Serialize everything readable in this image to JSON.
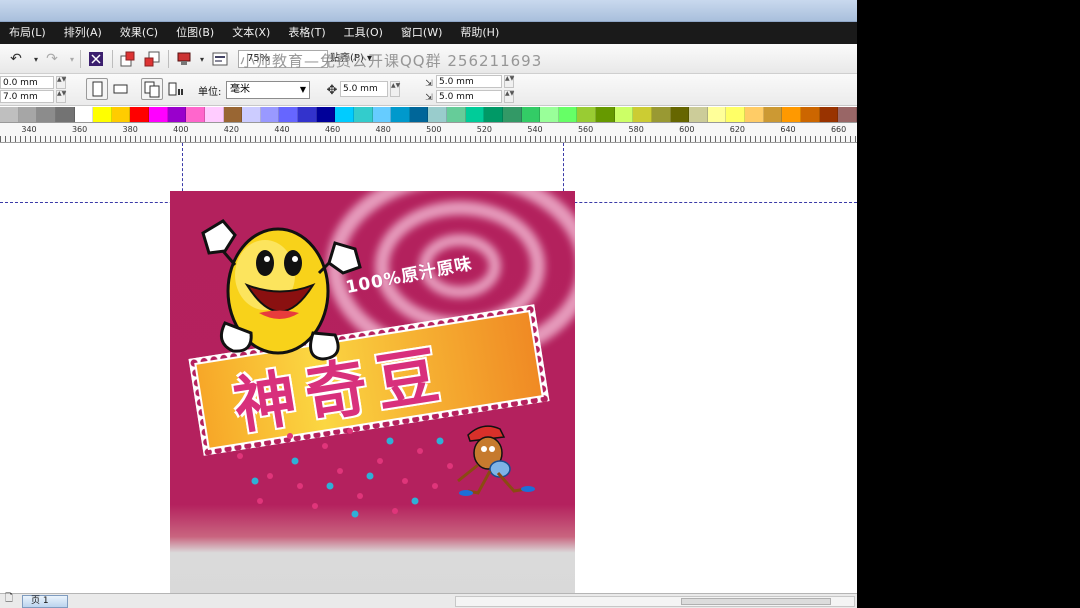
{
  "menu": [
    "布局(L)",
    "排列(A)",
    "效果(C)",
    "位图(B)",
    "文本(X)",
    "表格(T)",
    "工具(O)",
    "窗口(W)",
    "帮助(H)"
  ],
  "toolbar": {
    "zoom": "75%",
    "snap_label": "贴齐(P)",
    "watermark": "小帅教育—免费公开课QQ群  256211693"
  },
  "propbar": {
    "width_value": "0.0 mm",
    "height_value": "7.0 mm",
    "unit_label": "单位:",
    "unit_value": "毫米",
    "nudge_value": "5.0 mm",
    "dup_x": "5.0 mm",
    "dup_y": "5.0 mm"
  },
  "palette": [
    "#bfbfbf",
    "#a6a6a6",
    "#8c8c8c",
    "#737373",
    "#ffffff",
    "#ffff00",
    "#ffcc00",
    "#ff0000",
    "#ff00ff",
    "#9900cc",
    "#ff66cc",
    "#ffccff",
    "#996633",
    "#ccccff",
    "#9999ff",
    "#6666ff",
    "#3333cc",
    "#000099",
    "#00ccff",
    "#33cccc",
    "#66ccff",
    "#0099cc",
    "#006699",
    "#99cccc",
    "#66cc99",
    "#00cc99",
    "#009966",
    "#339966",
    "#33cc66",
    "#99ff99",
    "#66ff66",
    "#99cc33",
    "#669900",
    "#ccff66",
    "#cccc33",
    "#999933",
    "#666600",
    "#cccc99",
    "#ffff99",
    "#ffff66",
    "#ffcc66",
    "#cc9933",
    "#ff9900",
    "#cc6600",
    "#993300",
    "#996666"
  ],
  "ruler": {
    "labels": [
      "340",
      "360",
      "380",
      "400",
      "420",
      "440",
      "460",
      "480",
      "500",
      "520",
      "540",
      "560",
      "580",
      "600",
      "620",
      "640",
      "660"
    ]
  },
  "artwork": {
    "slogan": "100%原汁原味",
    "product_name": "神奇豆"
  },
  "status": {
    "page_tab": "页 1"
  }
}
